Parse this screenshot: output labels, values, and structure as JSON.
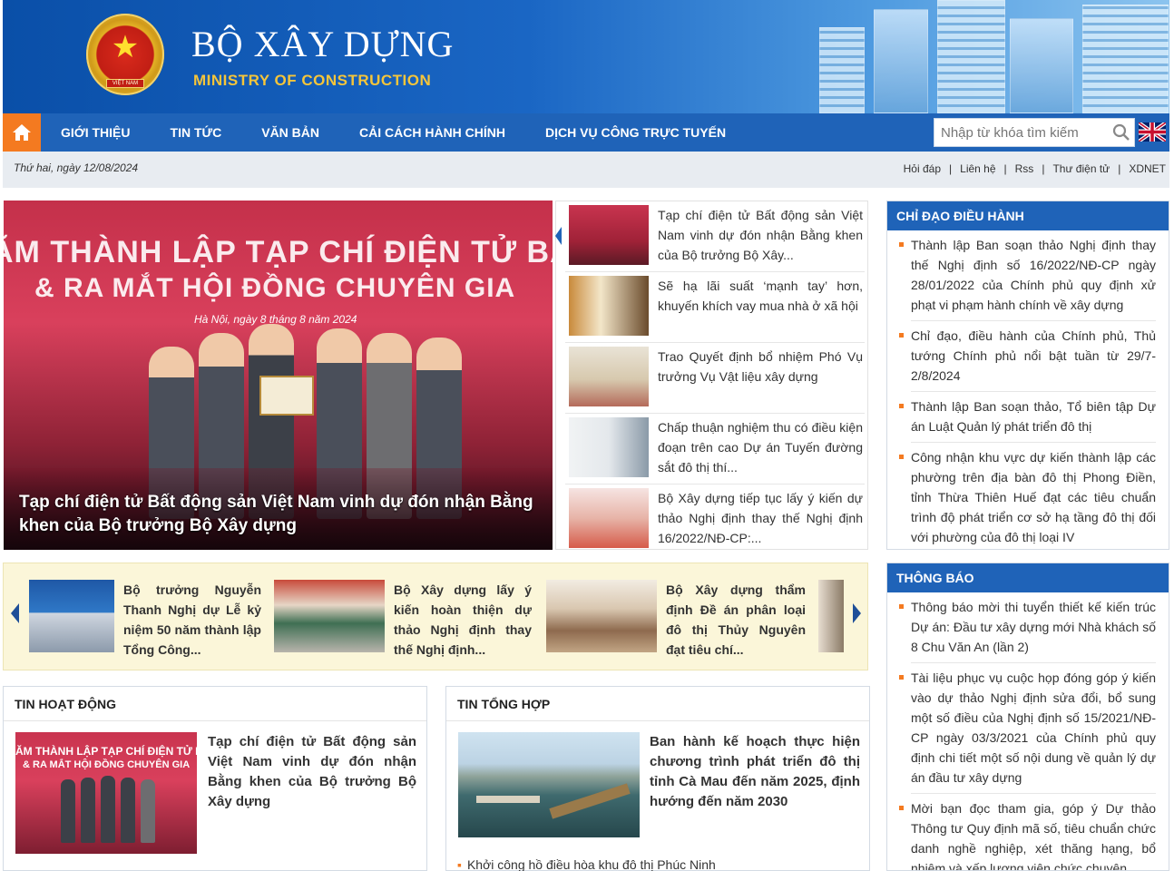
{
  "header": {
    "title": "BỘ XÂY DỰNG",
    "subtitle": "MINISTRY OF CONSTRUCTION",
    "emblem_ribbon": "VIỆT NAM"
  },
  "nav": {
    "home_icon": "home-icon",
    "items": [
      "GIỚI THIỆU",
      "TIN TỨC",
      "VĂN BẢN",
      "CẢI CÁCH HÀNH CHÍNH",
      "DỊCH VỤ CÔNG TRỰC TUYẾN"
    ],
    "search_placeholder": "Nhập từ khóa tìm kiếm",
    "search_icon": "search-icon",
    "language_icon": "uk-flag-icon"
  },
  "datebar": {
    "date": "Thứ hai, ngày 12/08/2024",
    "links": [
      "Hỏi đáp",
      "Liên hệ",
      "Rss",
      "Thư điện tử",
      "XDNET"
    ]
  },
  "hero": {
    "bg_line1": "ĂM THÀNH LẬP TẠP CHÍ ĐIỆN TỬ BẤ",
    "bg_line2": "& RA MẮT HỘI ĐỒNG CHUYÊN GIA",
    "bg_line3": "Hà Nội, ngày 8 tháng 8 năm 2024",
    "caption": "Tạp chí điện tử Bất động sản Việt Nam vinh dự đón nhận Bằng khen của Bộ trưởng Bộ Xây dựng"
  },
  "news_list": [
    "Tạp chí điện tử Bất động sản Việt Nam vinh dự đón nhận Bằng khen của Bộ trưởng Bộ Xây...",
    "Sẽ hạ lãi suất ‘mạnh tay’ hơn, khuyến khích vay mua nhà ở xã hội",
    "Trao Quyết định bổ nhiệm Phó Vụ trưởng Vụ Vật liệu xây dựng",
    "Chấp thuận nghiệm thu có điều kiện đoạn trên cao Dự án Tuyến đường sắt đô thị thí...",
    "Bộ Xây dựng tiếp tục lấy ý kiến dự thảo Nghị định thay thế Nghị định 16/2022/NĐ-CP:..."
  ],
  "chi_dao": {
    "title": "CHỈ ĐẠO ĐIỀU HÀNH",
    "items": [
      "Thành lập Ban soạn thảo Nghị định thay thế Nghị định số 16/2022/NĐ-CP ngày 28/01/2022 của Chính phủ quy định xử phạt vi phạm hành chính về xây dựng",
      "Chỉ đạo, điều hành của Chính phủ, Thủ tướng Chính phủ nổi bật tuần từ 29/7-2/8/2024",
      "Thành lập Ban soạn thảo, Tổ biên tập Dự án Luật Quản lý phát triển đô thị",
      "Công nhận khu vực dự kiến thành lập các phường trên địa bàn đô thị Phong Điền, tỉnh Thừa Thiên Huế đạt các tiêu chuẩn trình độ phát triển cơ sở hạ tầng đô thị đối với phường của đô thị loại IV"
    ]
  },
  "thong_bao": {
    "title": "THÔNG BÁO",
    "items": [
      "Thông báo mời thi tuyển thiết kế kiến trúc Dự án: Đầu tư xây dựng mới Nhà khách số 8 Chu Văn An (lần 2)",
      "Tài liệu phục vụ cuộc họp đóng góp ý kiến vào dự thảo Nghị định sửa đổi, bổ sung một số điều của Nghị định số 15/2021/NĐ-CP ngày 03/3/2021 của Chính phủ quy định chi tiết một số nội dung về quản lý dự án đầu tư xây dựng",
      "Mời bạn đọc tham gia, góp ý Dự thảo Thông tư Quy định mã số, tiêu chuẩn chức danh nghề nghiệp, xét thăng hạng, bổ nhiệm và xếp lương viên chức chuyên"
    ]
  },
  "carousel": {
    "items": [
      "Bộ trưởng Nguyễn Thanh Nghị dự Lễ kỷ niệm 50 năm thành lập Tổng Công...",
      "Bộ Xây dựng lấy ý kiến hoàn thiện dự thảo Nghị định thay thế Nghị định...",
      "Bộ Xây dựng thẩm định Đề án phân loại đô thị Thủy Nguyên đạt tiêu chí..."
    ]
  },
  "tin_hoat_dong": {
    "title": "TIN HOẠT ĐỘNG",
    "headline": "Tạp chí điện tử Bất động sản Việt Nam vinh dự đón nhận Bằng khen của Bộ trưởng Bộ Xây dựng",
    "thumb_line1": "ĂM THÀNH LẬP TẠP CHÍ ĐIỆN TỬ B",
    "thumb_line2": "& RA MẮT HỘI ĐỒNG CHUYÊN GIA"
  },
  "tin_tong_hop": {
    "title": "TIN TỔNG HỢP",
    "headline": "Ban hành kế hoạch thực hiện chương trình phát triển đô thị tỉnh Cà Mau đến năm 2025, định hướng đến năm 2030",
    "next": "Khởi công hồ điều hòa khu đô thị Phúc Ninh"
  },
  "colors": {
    "primary": "#1f63b8",
    "accent": "#f47a20",
    "carousel_bg": "#fbf6d9"
  }
}
